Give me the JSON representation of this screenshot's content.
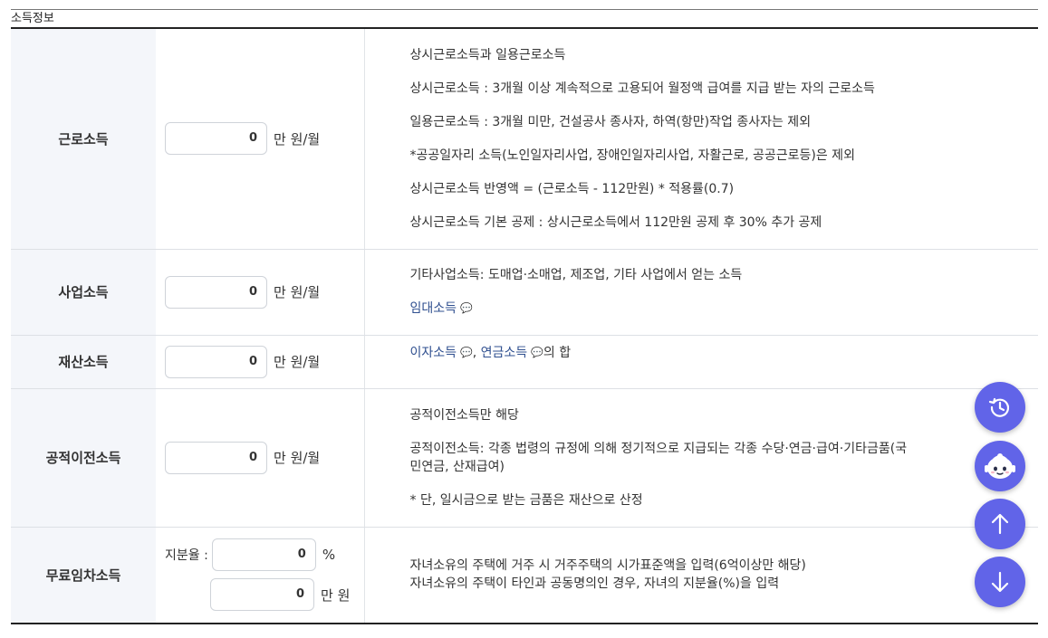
{
  "section": {
    "title": "소득정보"
  },
  "rows": [
    {
      "label": "근로소득",
      "value": "0",
      "unit": "만 원/월",
      "desc": [
        "상시근로소득과 일용근로소득",
        "상시근로소득 : 3개월 이상 계속적으로 고용되어 월정액 급여를 지급 받는 자의 근로소득",
        "일용근로소득 : 3개월 미만, 건설공사 종사자, 하역(항만)작업 종사자는 제외",
        "*공공일자리 소득(노인일자리사업, 장애인일자리사업, 자활근로, 공공근로등)은 제외",
        "상시근로소득 반영액 = (근로소득 - 112만원) * 적용률(0.7)",
        "상시근로소득 기본 공제 : 상시근로소득에서 112만원 공제 후 30% 추가 공제"
      ]
    },
    {
      "label": "사업소득",
      "value": "0",
      "unit": "만 원/월",
      "desc": [
        "기타사업소득: 도매업·소매업, 제조업, 기타 사업에서 얻는 소득"
      ],
      "link": "임대소득"
    },
    {
      "label": "재산소득",
      "value": "0",
      "unit": "만 원/월",
      "link1": "이자소득",
      "sep": ", ",
      "link2": "연금소득",
      "suffix": "의 합"
    },
    {
      "label": "공적이전소득",
      "value": "0",
      "unit": "만 원/월",
      "desc": [
        "공적이전소득만 해당",
        "공적이전소득: 각종 법령의 규정에 의해 정기적으로 지급되는 각종 수당·연금·급여·기타금품(국민연금, 산재급여)",
        "* 단, 일시금으로 받는 금품은 재산으로 산정"
      ]
    },
    {
      "label": "무료임차소득",
      "share_label": "지분율 :",
      "share_value": "0",
      "share_unit": "%",
      "value": "0",
      "unit": "만 원",
      "desc": [
        "자녀소유의 주택에 거주 시 거주주택의 시가표준액을 입력(6억이상만 해당)",
        "자녀소유의 주택이 타인과 공동명의인 경우, 자녀의 지분율(%)을 입력"
      ]
    }
  ],
  "icons": {
    "question": "question-bubble-icon"
  },
  "fabs": [
    {
      "name": "recent-history-icon"
    },
    {
      "name": "chatbot-icon"
    },
    {
      "name": "arrow-up-icon"
    },
    {
      "name": "arrow-down-icon"
    }
  ],
  "colors": {
    "accent": "#6164e8",
    "label_bg": "#f4f6fa",
    "link": "#2f4f8f"
  }
}
